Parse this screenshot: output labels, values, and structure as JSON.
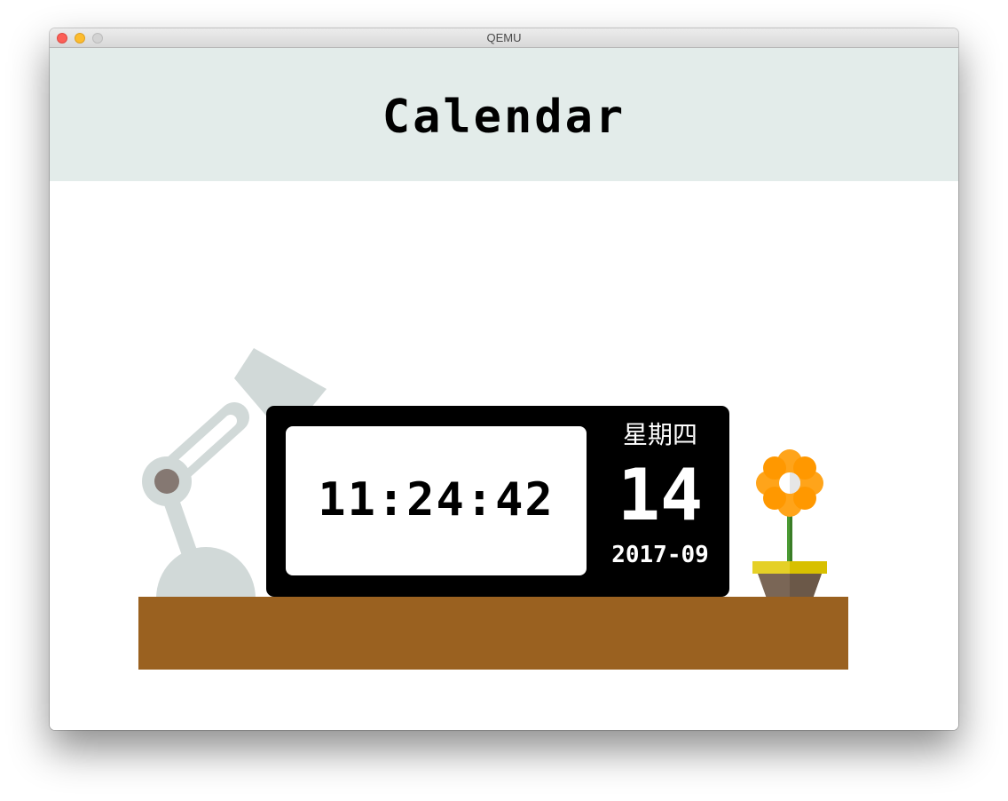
{
  "window": {
    "title": "QEMU",
    "controls": [
      "close",
      "minimize",
      "maximize"
    ]
  },
  "app": {
    "title": "Calendar"
  },
  "clock": {
    "time": "11:24:42",
    "weekday": "星期四",
    "day": "14",
    "year_month": "2017-09"
  },
  "scene": {
    "icons": [
      "desk-lamp-icon",
      "lamp-bulb-icon",
      "flower-pot-icon"
    ]
  },
  "colors": {
    "header_bg": "#e3ecea",
    "desk": "#9a6120",
    "lamp": "#d1d9d8",
    "bulb": "#ffee00",
    "flower": "#ff9800",
    "pot": "#7a6656",
    "pot_rim": "#e5d027"
  }
}
